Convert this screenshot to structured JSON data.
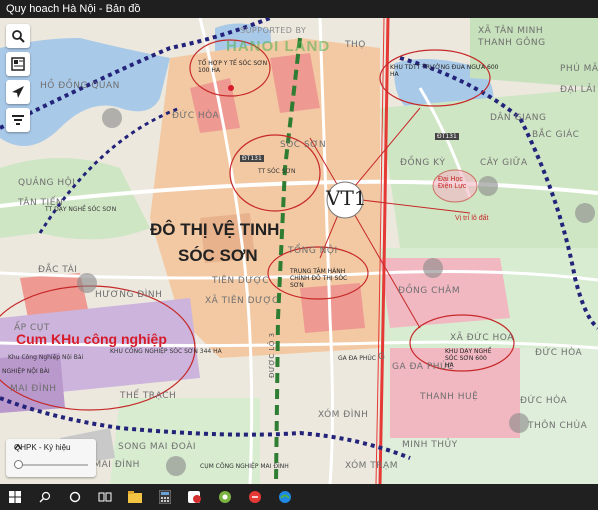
{
  "window": {
    "title": "Quy hoach Hà Nội - Bản đồ"
  },
  "map": {
    "labels": {
      "ho_dong_quan": "HỒ ĐỒNG QUAN",
      "duc_hoa_nw": "ĐỨC HÒA",
      "quang_hoi": "QUẢNG HỘI",
      "tan_tien": "TÂN TIẾN",
      "tt_day_nghe": "TT DẠY NGHỀ SÓC SƠN",
      "dac_tai": "ĐẮC TÀI",
      "huong_dinh": "HƯƠNG ĐÌNH",
      "ap_cut": "ẤP CỤT",
      "khu_cong_nghiep_noi_bai": "Khu Công Nghiệp Nội Bài",
      "khu_cn_soc_son": "KHU CÔNG NGHIỆP SÓC SƠN 344 HA",
      "nghiep_noi_bai": "NGHIỆP NỘI BÀI",
      "mai_dinh_w": "MAI ĐÌNH",
      "the_trach": "THẾ TRẠCH",
      "song_mai_doai": "SONG MAI ĐOÀI",
      "x_mai_dinh": "X. MAI ĐÌNH",
      "cum_cn_mai_dinh": "CỤM CÔNG NGHIỆP MAI ĐÌNH",
      "tien_duoc": "TIÊN DƯỢC",
      "xa_tien_duoc": "XÃ TIÊN DƯỢC",
      "tt_soc_son": "TT SÓC SƠN",
      "soc_son": "SÓC SƠN",
      "trung_tam_hanh_chinh": "TRUNG TÂM HÀNH CHÍNH ĐÔ THỊ SÓC SƠN",
      "tong_noi": "TỔNG NỘI",
      "xom_dinh": "XÓM ĐÌNH",
      "xom_tram": "XÓM TRẠM",
      "ga_da_phuc": "GA ĐA PHÚC",
      "thanh_hue": "THANH HUỆ",
      "minh_thuy": "MINH THỦY",
      "dong_cham": "ĐỒNG CHÂM",
      "xa_duc_hoa": "XÃ ĐỨC HOÀ",
      "khu_day_nghe": "KHU DẠY NGHỀ SÓC SƠN 600 HA",
      "duc_hoa_e": "ĐỨC HÒA",
      "duc_hoa_se": "ĐỨC HÒA",
      "thon_chua": "THÔN CHÙA",
      "dong_ky": "ĐỒNG KỲ",
      "cay_giua": "CÂY GIỮA",
      "dai_hoc_dien_luc": "Đại Học Điện Lực",
      "vi_tri_lo_dat": "Vị trí lô đất",
      "xa_tan_minh": "XÃ TÂN MINH",
      "thanh_gong": "THANH GÔNG",
      "phu_mau": "PHÚ MÃ",
      "dan_giang": "DÂN GIANG",
      "bac_giac": "BẮC GIÁC",
      "dai_lai_cac": "ĐẠI LẢI CÁC",
      "khu_tdtt": "KHU TDTT TRƯỜNG ĐUA NGỰA 600 HA",
      "to_hop_y_te": "TỔ HỢP Y TẾ SÓC SƠN 100 HA",
      "tho": "THỌ",
      "duc_lo_3": "ĐƯỢC LỘ 3",
      "d131_label": "ĐT131",
      "d131_label2": "ĐT131",
      "ga_label": "G"
    },
    "overlays": {
      "do_thi_line1": "ĐÔ THỊ VỆ TINH",
      "do_thi_line2": "SÓC SƠN",
      "cum_khu": "Cum KHu công nghiệp",
      "vt1": "VT1",
      "watermark": "HANOI LAND",
      "supported_by": "SUPPORTED BY"
    },
    "colors": {
      "brand_watermark": "#4caf50",
      "annotation_red": "#d81b2a",
      "boundary_navy": "#23237a",
      "railway_red": "#e53935",
      "highway_green": "#2e7d32"
    }
  },
  "controls": {
    "tools": [
      "search-icon",
      "layers-icon",
      "navigation-icon",
      "filter-icon"
    ],
    "legend": {
      "label": "QHPK - Ký hiệu"
    }
  },
  "taskbar": {
    "icons": [
      "windows-start-icon",
      "search-icon",
      "cortana-icon",
      "task-view-icon",
      "file-explorer-icon",
      "calculator-icon",
      "app-red-icon",
      "app-green-icon",
      "app-red-circle-icon",
      "edge-icon"
    ]
  }
}
